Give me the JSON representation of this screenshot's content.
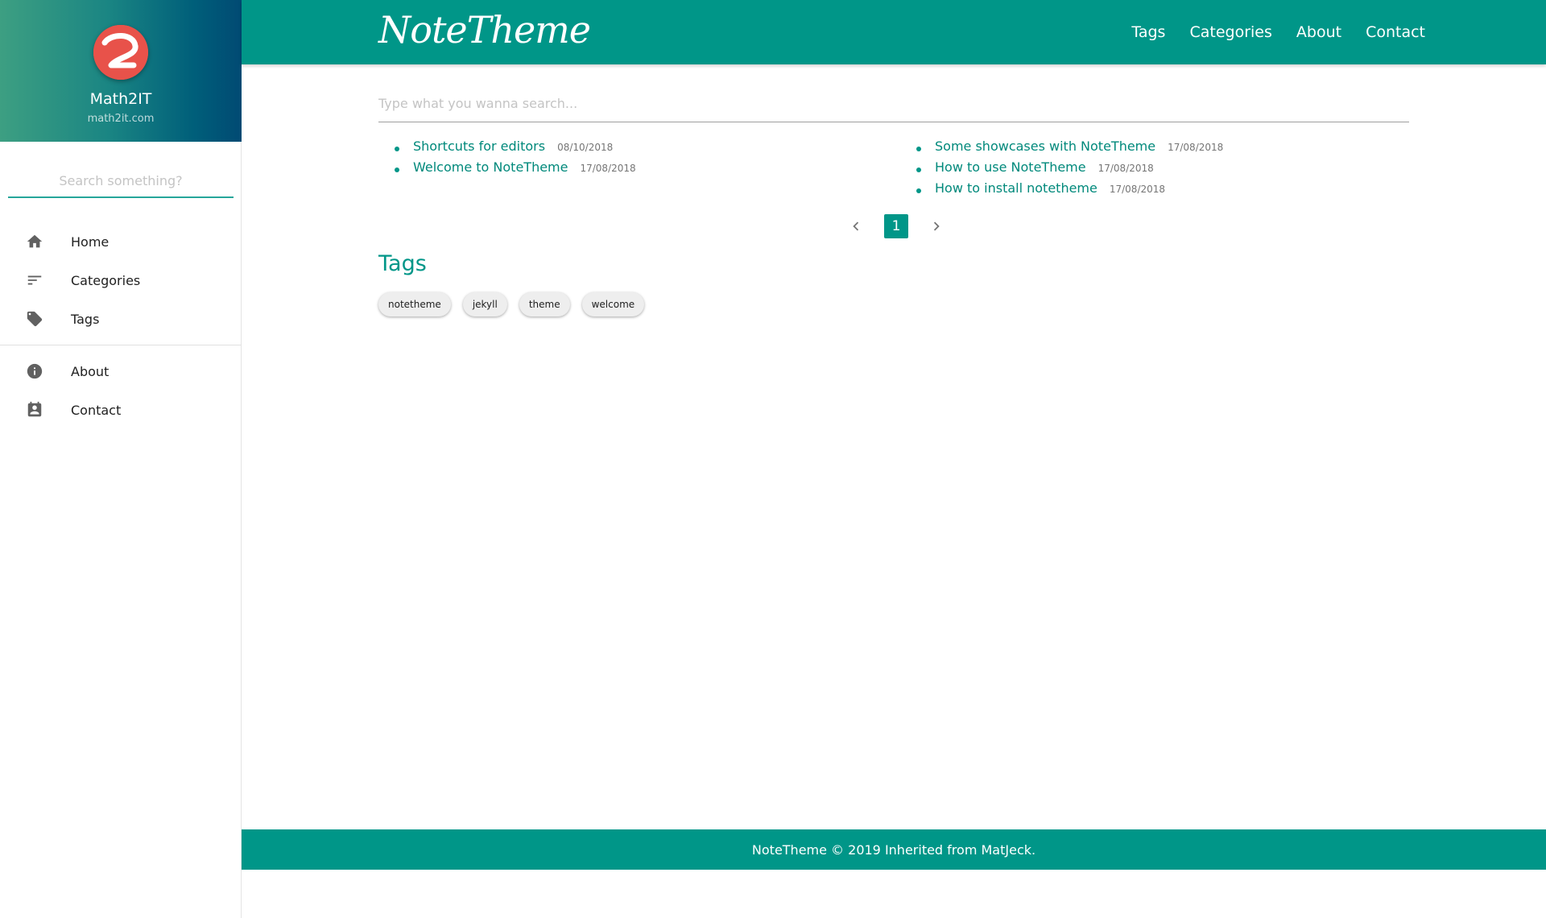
{
  "sidebar": {
    "brand_name": "Math2IT",
    "brand_url": "math2it.com",
    "search_placeholder": "Search something?",
    "items": [
      {
        "label": "Home",
        "icon": "home-icon"
      },
      {
        "label": "Categories",
        "icon": "sort-icon"
      },
      {
        "label": "Tags",
        "icon": "tag-icon"
      },
      {
        "label": "About",
        "icon": "info-icon"
      },
      {
        "label": "Contact",
        "icon": "contact-icon"
      }
    ]
  },
  "header": {
    "logo_text": "NoteTheme",
    "nav": [
      "Tags",
      "Categories",
      "About",
      "Contact"
    ]
  },
  "main": {
    "search_placeholder": "Type what you wanna search...",
    "posts_left": [
      {
        "title": "Shortcuts for editors",
        "date": "08/10/2018"
      },
      {
        "title": "Welcome to NoteTheme",
        "date": "17/08/2018"
      }
    ],
    "posts_right": [
      {
        "title": "Some showcases with NoteTheme",
        "date": "17/08/2018"
      },
      {
        "title": "How to use NoteTheme",
        "date": "17/08/2018"
      },
      {
        "title": "How to install notetheme",
        "date": "17/08/2018"
      }
    ],
    "pagination": {
      "current": "1"
    },
    "tags_title": "Tags",
    "tags": [
      "notetheme",
      "jekyll",
      "theme",
      "welcome"
    ]
  },
  "footer": {
    "text": "NoteTheme © 2019 Inherited from MatJeck."
  },
  "colors": {
    "primary": "#009688",
    "link": "#00897b",
    "logo_red": "#e8524a"
  }
}
